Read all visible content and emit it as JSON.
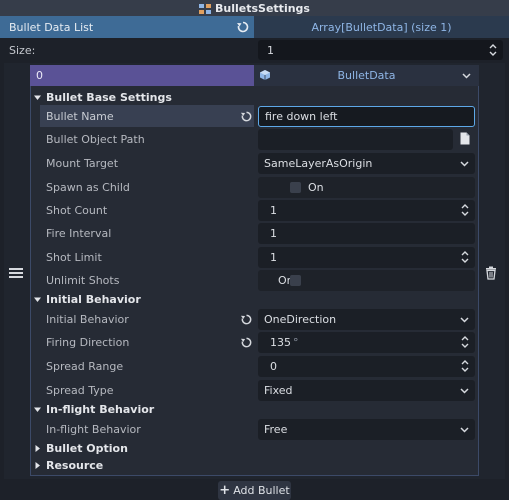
{
  "window": {
    "title": "BulletsSettings"
  },
  "property": {
    "label": "Bullet Data List",
    "value": "Array[BulletData] (size 1)"
  },
  "size": {
    "label": "Size:",
    "value": "1"
  },
  "element": {
    "index": "0",
    "resource_type": "BulletData"
  },
  "sections": {
    "base": "Bullet Base Settings",
    "initial": "Initial Behavior",
    "inflight": "In-flight Behavior",
    "option": "Bullet Option",
    "resource": "Resource"
  },
  "fields": {
    "bullet_name": {
      "label": "Bullet Name",
      "value": "fire down left"
    },
    "bullet_object_path": {
      "label": "Bullet Object Path",
      "value": ""
    },
    "mount_target": {
      "label": "Mount Target",
      "value": "SameLayerAsOrigin"
    },
    "spawn_as_child": {
      "label": "Spawn as Child",
      "value": "On"
    },
    "shot_count": {
      "label": "Shot Count",
      "value": "1"
    },
    "fire_interval": {
      "label": "Fire Interval",
      "value": "1"
    },
    "shot_limit": {
      "label": "Shot Limit",
      "value": "1"
    },
    "unlimit_shots": {
      "label": "Unlimit Shots",
      "value": "On"
    },
    "initial_behavior": {
      "label": "Initial Behavior",
      "value": "OneDirection"
    },
    "firing_direction": {
      "label": "Firing Direction",
      "value": "135",
      "unit": "°"
    },
    "spread_range": {
      "label": "Spread Range",
      "value": "0"
    },
    "spread_type": {
      "label": "Spread Type",
      "value": "Fixed"
    },
    "inflight_behavior": {
      "label": "In-flight Behavior",
      "value": "Free"
    }
  },
  "add_button": {
    "label": "Add Bullet"
  },
  "colors": {
    "accent": "#5da8e8",
    "selected_element": "#5a5296",
    "property_header": "#3e6b96"
  }
}
